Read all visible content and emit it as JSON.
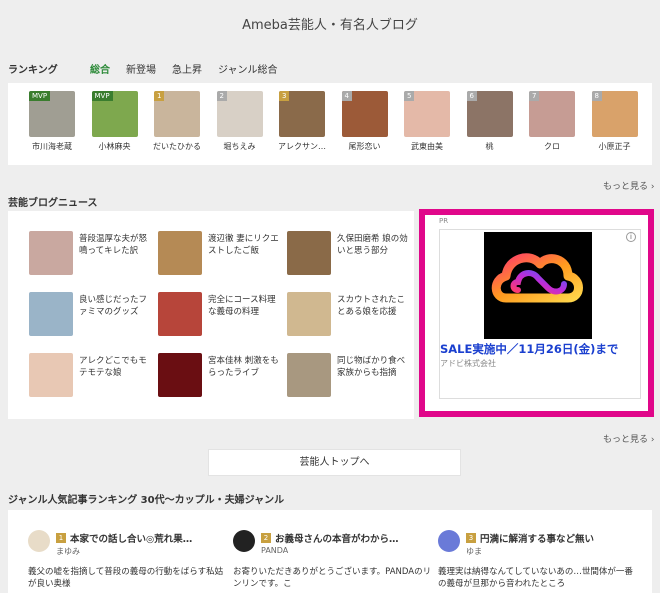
{
  "header": {
    "title": "Ameba芸能人・有名人ブログ"
  },
  "ranking": {
    "label": "ランキング",
    "tabs": [
      "総合",
      "新登場",
      "急上昇",
      "ジャンル総合"
    ],
    "active_tab": 0,
    "items": [
      {
        "name": "市川海老蔵",
        "badge": "MVP",
        "badge_type": "mvp",
        "color": "#a09e93"
      },
      {
        "name": "小林麻央",
        "badge": "MVP",
        "badge_type": "mvp",
        "color": "#7ea84e"
      },
      {
        "name": "だいたひかる",
        "badge": "1",
        "badge_type": "gold",
        "color": "#c9b59c"
      },
      {
        "name": "堀ちえみ",
        "badge": "2",
        "badge_type": "gray",
        "color": "#d8d0c6"
      },
      {
        "name": "アレクサン…",
        "badge": "3",
        "badge_type": "gold",
        "color": "#8a6a4a"
      },
      {
        "name": "尾形恋い",
        "badge": "4",
        "badge_type": "gray",
        "color": "#9c5a38"
      },
      {
        "name": "武東由美",
        "badge": "5",
        "badge_type": "gray",
        "color": "#e4b9a8"
      },
      {
        "name": "桃",
        "badge": "6",
        "badge_type": "gray",
        "color": "#8c7466"
      },
      {
        "name": "クロ",
        "badge": "7",
        "badge_type": "gray",
        "color": "#c69c94"
      },
      {
        "name": "小原正子",
        "badge": "8",
        "badge_type": "gray",
        "color": "#d9a26a"
      }
    ],
    "more": "もっと見る"
  },
  "news": {
    "label": "芸能ブログニュース",
    "items": [
      {
        "text": "普段温厚な夫が怒鳴ってキレた訳",
        "color": "#c9a8a0"
      },
      {
        "text": "渡辺徹 妻にリクエストしたご飯",
        "color": "#b58a55"
      },
      {
        "text": "久保田磨希 娘の効いと思う部分",
        "color": "#8a6a48"
      },
      {
        "text": "良い感じだったファミマのグッズ",
        "color": "#9ab4c8"
      },
      {
        "text": "完全にコース料理な義母の料理",
        "color": "#b7453a"
      },
      {
        "text": "スカウトされたことある娘を応援",
        "color": "#d0b890"
      },
      {
        "text": "アレクどこでもモテモテな娘",
        "color": "#e8c8b4"
      },
      {
        "text": "宮本佳林 刺激をもらったライブ",
        "color": "#6a0e12"
      },
      {
        "text": "同じ物ばかり食べ家族からも指摘",
        "color": "#a89880"
      }
    ],
    "more": "もっと見る"
  },
  "ad": {
    "pr": "PR",
    "info_icon": "info-icon",
    "headline": "SALE実施中／11月26日(金)まで",
    "advertiser": "アドビ株式会社",
    "frame_color": "#e0078a"
  },
  "top_button": "芸能人トップへ",
  "genre": {
    "label": "ジャンル人気記事ランキング 30代～カップル・夫婦ジャンル",
    "items": [
      {
        "rank": "1",
        "title": "本家での話し合い◎荒れ果…",
        "author": "まゆみ",
        "text": "義父の嘘を指摘して普段の義母の行動をばらす私姑が良い奥様",
        "icon_color": "#e8dcc8"
      },
      {
        "rank": "2",
        "title": "お義母さんの本音がわから…",
        "author": "PANDA",
        "text": "お寄りいただきありがとうございます。PANDAのリンリンです。こ",
        "icon_color": "#222222"
      },
      {
        "rank": "3",
        "title": "円満に解消する事など無い",
        "author": "ゆま",
        "text": "義理実は納得なんてしていないあの…世間体が一番の義母が旦那から音われたところ",
        "icon_color": "#6a7ad8"
      }
    ]
  }
}
